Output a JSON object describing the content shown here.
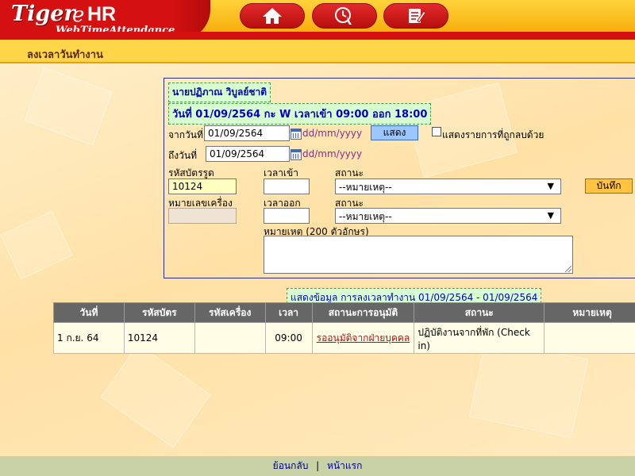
{
  "logo": {
    "tiger": "Tiger",
    "e": "e",
    "hr": "HR",
    "sub": "WebTimeAttendance"
  },
  "nav": [
    {
      "icon": "home-icon"
    },
    {
      "icon": "hand-pointer-icon"
    },
    {
      "icon": "report-edit-icon"
    }
  ],
  "page_title": "ลงเวลาวันทำงาน",
  "employee_name": "นายปฏิภาณ วิบูลย์ชาติ",
  "shift_info": "วันที่ 01/09/2564 กะ W เวลาเข้า 09:00 ออก 18:00",
  "form": {
    "from_date_label": "จากวันที่",
    "from_date_value": "01/09/2564",
    "to_date_label": "ถึงวันที่",
    "to_date_value": "01/09/2564",
    "date_format": "dd/mm/yyyy",
    "show_button": "แสดง",
    "show_deleted_label": "แสดงรายการที่ถูกลบด้วย",
    "card_id_label": "รหัสบัตรรูด",
    "card_id_value": "10124",
    "time_in_label": "เวลาเข้า",
    "status_in_label": "สถานะ",
    "status_in_value": "--หมายเหตุ--",
    "save_button": "บันทึก",
    "machine_label": "หมายเลขเครื่อง",
    "time_out_label": "เวลาออก",
    "status_out_label": "สถานะ",
    "status_out_value": "--หมายเหตุ--",
    "remark_label": "หมายเหตุ (200 ตัวอักษร)"
  },
  "info_text": "แสดงข้อมูล การลงเวลาทำงาน 01/09/2564 - 01/09/2564",
  "table": {
    "headers": [
      "วันที่",
      "รหัสบัตร",
      "รหัสเครื่อง",
      "เวลา",
      "สถานะการอนุมัติ",
      "สถานะ",
      "หมายเหตุ"
    ],
    "rows": [
      {
        "date": "1 ก.ย. 64",
        "card": "10124",
        "machine": "",
        "time": "09:00",
        "approval": "รออนุมัติจากฝ่ายบุคคล",
        "status": "ปฏิบัติงานจากที่พัก (Check in)",
        "remark": ""
      }
    ]
  },
  "footer": {
    "back": "ย้อนกลับ",
    "sep": "|",
    "home": "หน้าแรก"
  },
  "colors": {
    "header_red": "#d41010",
    "header_yellow": "#ffd23b",
    "info_green": "#d8ffd0",
    "table_header": "#666666"
  }
}
